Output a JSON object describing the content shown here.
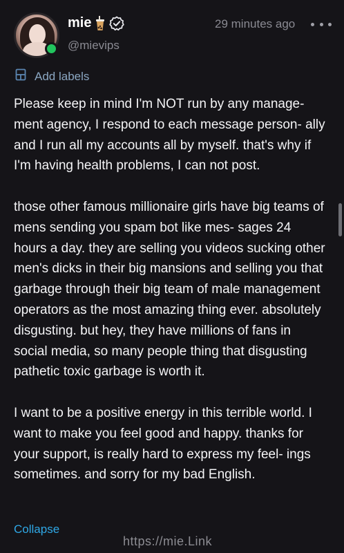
{
  "post": {
    "display_name": "mie",
    "name_emoji_icon": "bubble-tea-cup-icon",
    "verified_icon": "verified-badge-icon",
    "handle": "@mievips",
    "timestamp": "29 minutes ago",
    "more_icon": "more-dots-icon",
    "online_status_color": "#22c55e",
    "labels_icon": "labels-icon",
    "add_labels": "Add labels",
    "paragraphs": [
      "Please keep in mind I'm NOT run by any manage- ment agency, I respond to each message person- ally and I run all my accounts all by myself. that's why if I'm having health problems, I can not post.",
      "those other famous millionaire girls have big teams of mens sending you spam bot like mes- sages 24 hours a day. they are selling you videos sucking other men's dicks in their big mansions and selling you that garbage through their big team of male management operators as the most amazing thing ever. absolutely disgusting. but hey, they have millions of fans in social media, so many people thing that disgusting pathetic toxic garbage is worth it.",
      "I want to be a positive energy in this terrible world. I want to make you feel good and happy. thanks for your support, is really hard to express my feel- ings sometimes. and sorry for my bad English."
    ],
    "collapse_label": "Collapse"
  },
  "watermark": "https://mie.Link",
  "colors": {
    "background": "#151418",
    "text": "#f4f4f6",
    "muted": "#8a8a92",
    "link": "#2fa8e6",
    "label_accent": "#8ba7c2"
  }
}
